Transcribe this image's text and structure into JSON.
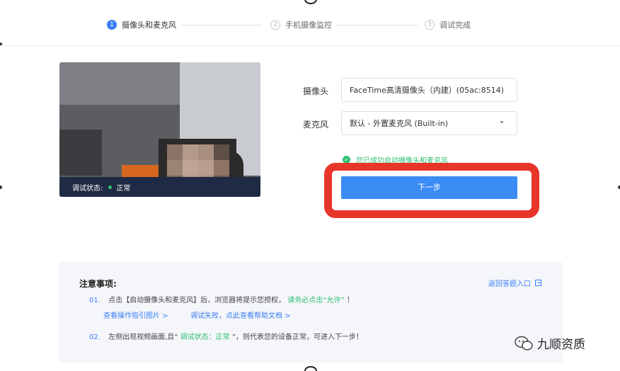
{
  "steps": [
    {
      "num": "1",
      "label": "摄像头和麦克风"
    },
    {
      "num": "2",
      "label": "手机摄像监控"
    },
    {
      "num": "3",
      "label": "调试完成"
    }
  ],
  "video": {
    "status_label": "调试状态:",
    "status_value": "正常"
  },
  "form": {
    "camera_label": "摄像头",
    "camera_value": "FaceTime高清摄像头（内建）(05ac:8514)",
    "mic_label": "麦克风",
    "mic_value": "默认 - 外置麦克风 (Built-in)",
    "success_text": "您已成功启动摄像头和麦克风",
    "next_button": "下一步"
  },
  "notes": {
    "title": "注意事项:",
    "return_link": "返回答题入口",
    "item1_num": "01.",
    "item1_text": "点击【启动摄像头和麦克风】后，浏览器将提示您授权，",
    "item1_emphasis": "请务必点击“允许”",
    "item1_end": "！",
    "link_guide": "查看操作指引图片 >",
    "link_help": "调试失败，点此查看帮助文档 >",
    "item2_num": "02.",
    "item2_text_a": "左侧出现视频画面,且“",
    "item2_emphasis": "调试状态：正常",
    "item2_text_b": "”，则代表您的设备正常，可进入下一步！"
  },
  "watermark": {
    "text": "九顺资质"
  },
  "colors": {
    "primary": "#3b8bf5",
    "success": "#2fbf71",
    "highlight": "#e8352a",
    "video_bar": "#1f2a44"
  }
}
